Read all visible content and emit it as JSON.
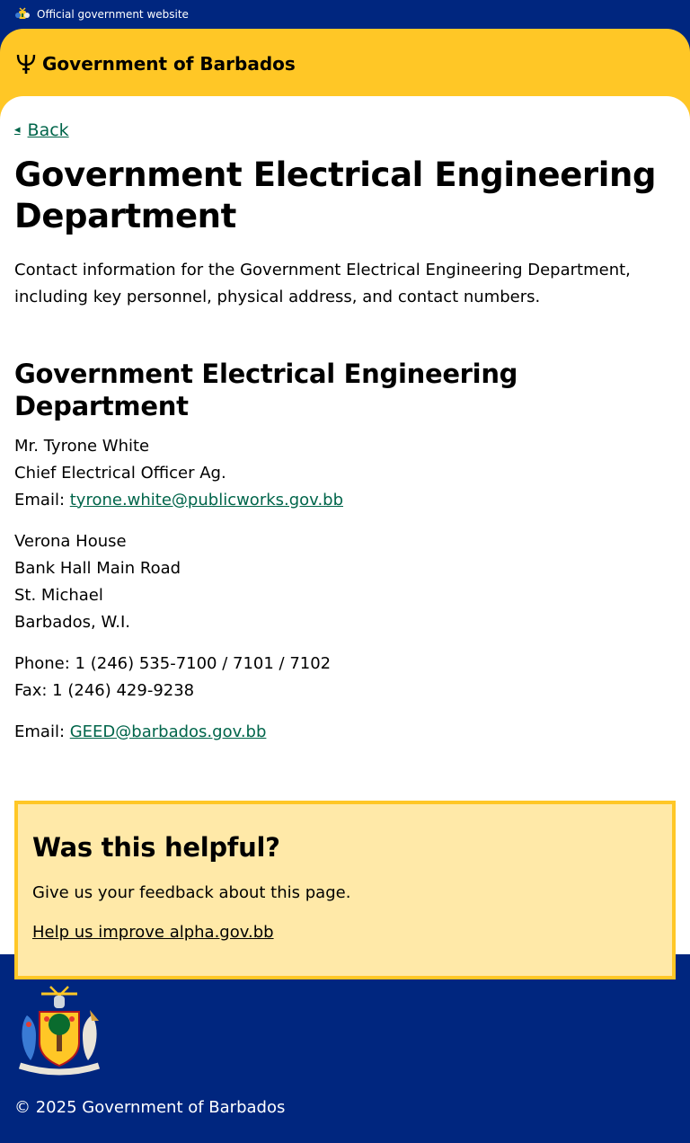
{
  "topbar": {
    "official_label": "Official government website"
  },
  "header": {
    "brand_name": "Government of Barbados"
  },
  "nav": {
    "back_label": "Back"
  },
  "page": {
    "title": "Government Electrical Engineering Department",
    "lead": "Contact information for the Government Electrical Engineering Department, including key personnel, physical address, and contact numbers.",
    "section_title": "Government Electrical Engineering Department",
    "contact": {
      "name": "Mr. Tyrone White",
      "role": "Chief Electrical Officer Ag.",
      "email_label": "Email: ",
      "email": "tyrone.white@publicworks.gov.bb"
    },
    "address": [
      "Verona House",
      "Bank Hall Main Road",
      "St. Michael",
      "Barbados, W.I."
    ],
    "phone": "Phone: 1 (246) 535-7100 / 7101 / 7102",
    "fax": "Fax: 1 (246) 429-9238",
    "general_email_label": "Email: ",
    "general_email": "GEED@barbados.gov.bb"
  },
  "feedback": {
    "title": "Was this helpful?",
    "text": "Give us your feedback about this page.",
    "link": "Help us improve alpha.gov.bb"
  },
  "footer": {
    "copyright": "© 2025 Government of Barbados"
  },
  "colors": {
    "navy": "#00267f",
    "yellow": "#ffc726",
    "feedback_bg": "#ffe9a8",
    "link_green": "#00654a"
  },
  "icons": {
    "coat_of_arms": "barbados-coat-of-arms-icon",
    "trident": "trident-icon",
    "back_arrow": "arrow-left-icon"
  }
}
